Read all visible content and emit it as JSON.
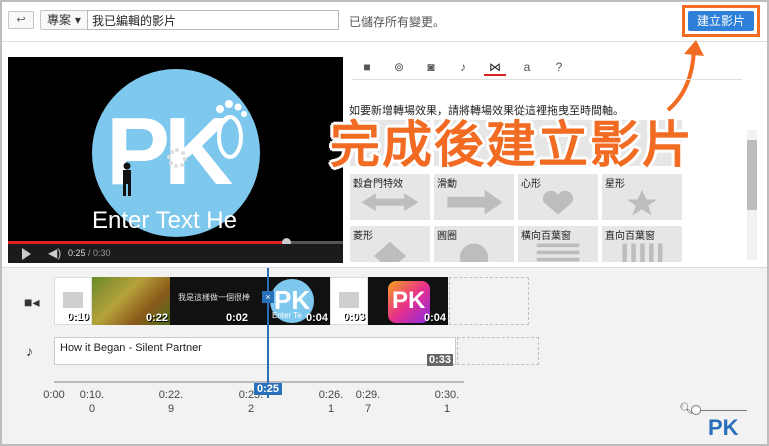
{
  "toolbar": {
    "back_icon": "back-arrow-icon",
    "project_label": "專案",
    "project_caret": "▾",
    "title_value": "我已編輯的影片",
    "saved_status": "已儲存所有變更。",
    "create_label": "建立影片",
    "highlight_color": "#f26b22"
  },
  "preview": {
    "logo_text": "PK",
    "caption_text": "Enter Text He",
    "current_time": "0:25",
    "total_time": "/ 0:30",
    "progress": 0.82
  },
  "tabs": [
    {
      "icon": "video-icon",
      "glyph": "■"
    },
    {
      "icon": "filter-icon",
      "glyph": "⊚"
    },
    {
      "icon": "camera-icon",
      "glyph": "◙"
    },
    {
      "icon": "music-icon",
      "glyph": "♪"
    },
    {
      "icon": "transition-icon",
      "glyph": "⋈",
      "active": true
    },
    {
      "icon": "text-icon",
      "glyph": "a"
    },
    {
      "icon": "help-icon",
      "glyph": "?"
    }
  ],
  "instruction": "如要新增轉場效果，請將轉場效果從這裡拖曳至時間軸。",
  "overlay_caption": "完成後建立影片",
  "transitions": [
    {
      "label": "穀倉門特效",
      "shape": "arrows"
    },
    {
      "label": "滑動",
      "shape": "arrow-right"
    },
    {
      "label": "心形",
      "shape": "heart"
    },
    {
      "label": "星形",
      "shape": "star"
    },
    {
      "label": "菱形",
      "shape": "diamond"
    },
    {
      "label": "圓圈",
      "shape": "circle"
    },
    {
      "label": "橫向百葉窗",
      "shape": "h-blinds"
    },
    {
      "label": "直向百葉窗",
      "shape": "v-blinds"
    }
  ],
  "timeline": {
    "video_icon": "video-track-icon",
    "audio_icon": "music-note-icon",
    "clips": [
      {
        "duration": "0:10",
        "kind": "gray"
      },
      {
        "duration": "0:22",
        "kind": "flowers"
      },
      {
        "duration": "0:02",
        "kind": "text",
        "text": "我是這樣做一個很棒"
      },
      {
        "duration": "0:04",
        "kind": "pk",
        "text": "Enter Te"
      },
      {
        "duration": "0:03",
        "kind": "gray"
      },
      {
        "duration": "0:04",
        "kind": "pk-gradient"
      }
    ],
    "audio_title": "How it Began - Silent Partner",
    "audio_duration": "0:33",
    "playhead_time": "0:25",
    "ticks": [
      {
        "top": "0:00",
        "bottom": ""
      },
      {
        "top": "0:10.",
        "bottom": "0"
      },
      {
        "top": "0:22.",
        "bottom": "9"
      },
      {
        "top": "0:25.",
        "bottom": "2"
      },
      {
        "top": "0:26.",
        "bottom": "1"
      },
      {
        "top": "0:29.",
        "bottom": "7"
      },
      {
        "top": "0:30.",
        "bottom": "1"
      }
    ]
  },
  "watermark": "PK"
}
